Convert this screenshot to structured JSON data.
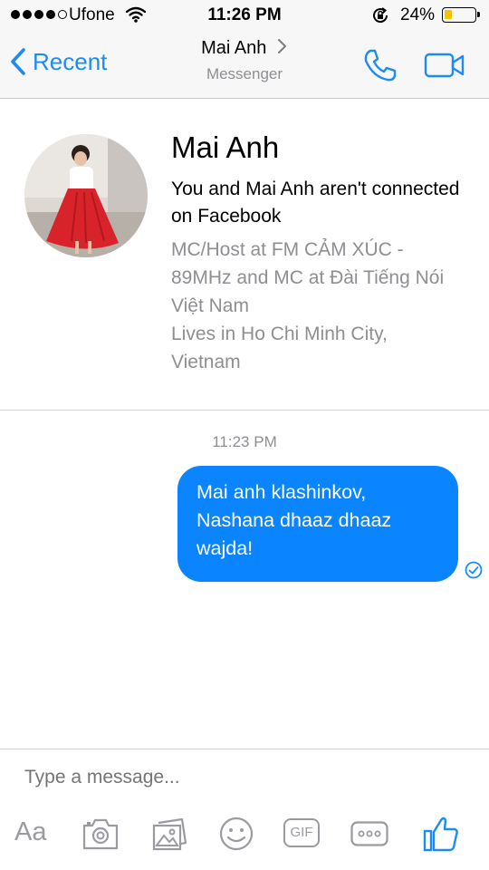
{
  "status_bar": {
    "carrier": "Ufone",
    "time": "11:26 PM",
    "battery_percent": "24%",
    "battery_level": 0.24,
    "signal_bars_filled": 4,
    "signal_bars_total": 5
  },
  "nav": {
    "back_label": "Recent",
    "title": "Mai Anh",
    "subtitle": "Messenger"
  },
  "profile": {
    "name": "Mai Anh",
    "connection_note": "You and Mai Anh aren't connected on Facebook",
    "details": [
      "MC/Host at FM CẢM XÚC - 89MHz and MC at Đài Tiếng Nói Việt Nam",
      "Lives in Ho Chi Minh City, Vietnam"
    ]
  },
  "conversation": {
    "timestamp": "11:23 PM",
    "messages": [
      {
        "text": "Mai anh klashinkov,\nNashana dhaaz dhaaz\nwajda!",
        "sender": "me",
        "status": "sent"
      }
    ]
  },
  "composer": {
    "placeholder": "Type a message...",
    "aa_label": "Aa",
    "gif_label": "GIF"
  },
  "colors": {
    "accent": "#1e8bf1",
    "bubble": "#0a84ff",
    "muted": "#8e8e93",
    "icon_gray": "#9a9aa0"
  }
}
